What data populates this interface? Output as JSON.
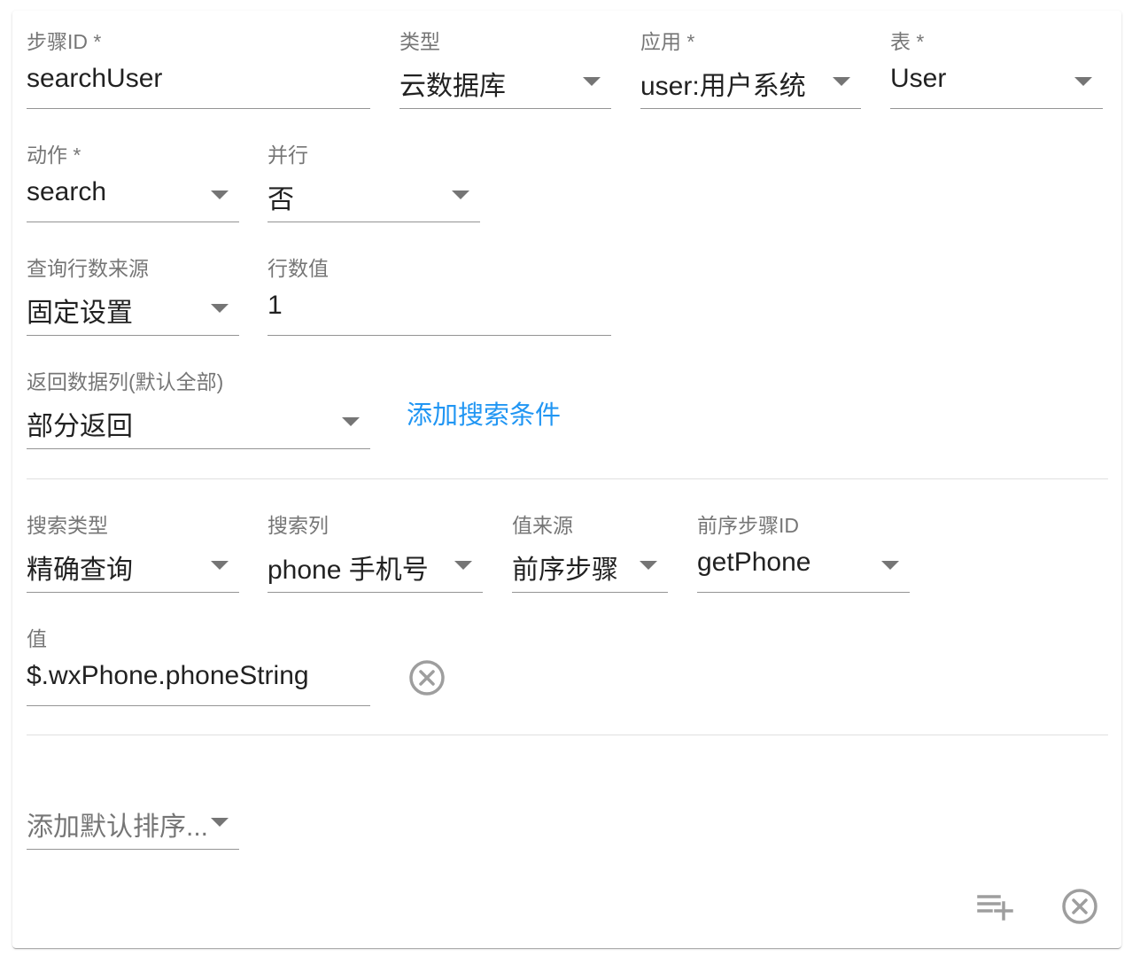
{
  "step": {
    "step_id": {
      "label": "步骤ID *",
      "value": "searchUser"
    },
    "type": {
      "label": "类型",
      "value": "云数据库"
    },
    "app": {
      "label": "应用 *",
      "value": "user:用户系统"
    },
    "table": {
      "label": "表 *",
      "value": "User"
    },
    "action": {
      "label": "动作 *",
      "value": "search"
    },
    "parallel": {
      "label": "并行",
      "value": "否"
    },
    "row_source": {
      "label": "查询行数来源",
      "value": "固定设置"
    },
    "row_count": {
      "label": "行数值",
      "value": "1"
    },
    "return_cols": {
      "label": "返回数据列(默认全部)",
      "value": "部分返回"
    },
    "add_condition_label": "添加搜索条件"
  },
  "condition": {
    "search_type": {
      "label": "搜索类型",
      "value": "精确查询"
    },
    "search_col": {
      "label": "搜索列",
      "value": "phone 手机号"
    },
    "value_source": {
      "label": "值来源",
      "value": "前序步骤"
    },
    "prev_step_id": {
      "label": "前序步骤ID",
      "value": "getPhone"
    },
    "value": {
      "label": "值",
      "value": "$.wxPhone.phoneString"
    },
    "remove_icon": "close-circle-outline-icon"
  },
  "sort": {
    "placeholder": "添加默认排序..."
  },
  "actions": {
    "add_row_icon": "playlist-plus-icon",
    "remove_step_icon": "close-circle-outline-icon"
  },
  "colors": {
    "accent": "#2196f3",
    "icon": "#9e9e9e"
  }
}
